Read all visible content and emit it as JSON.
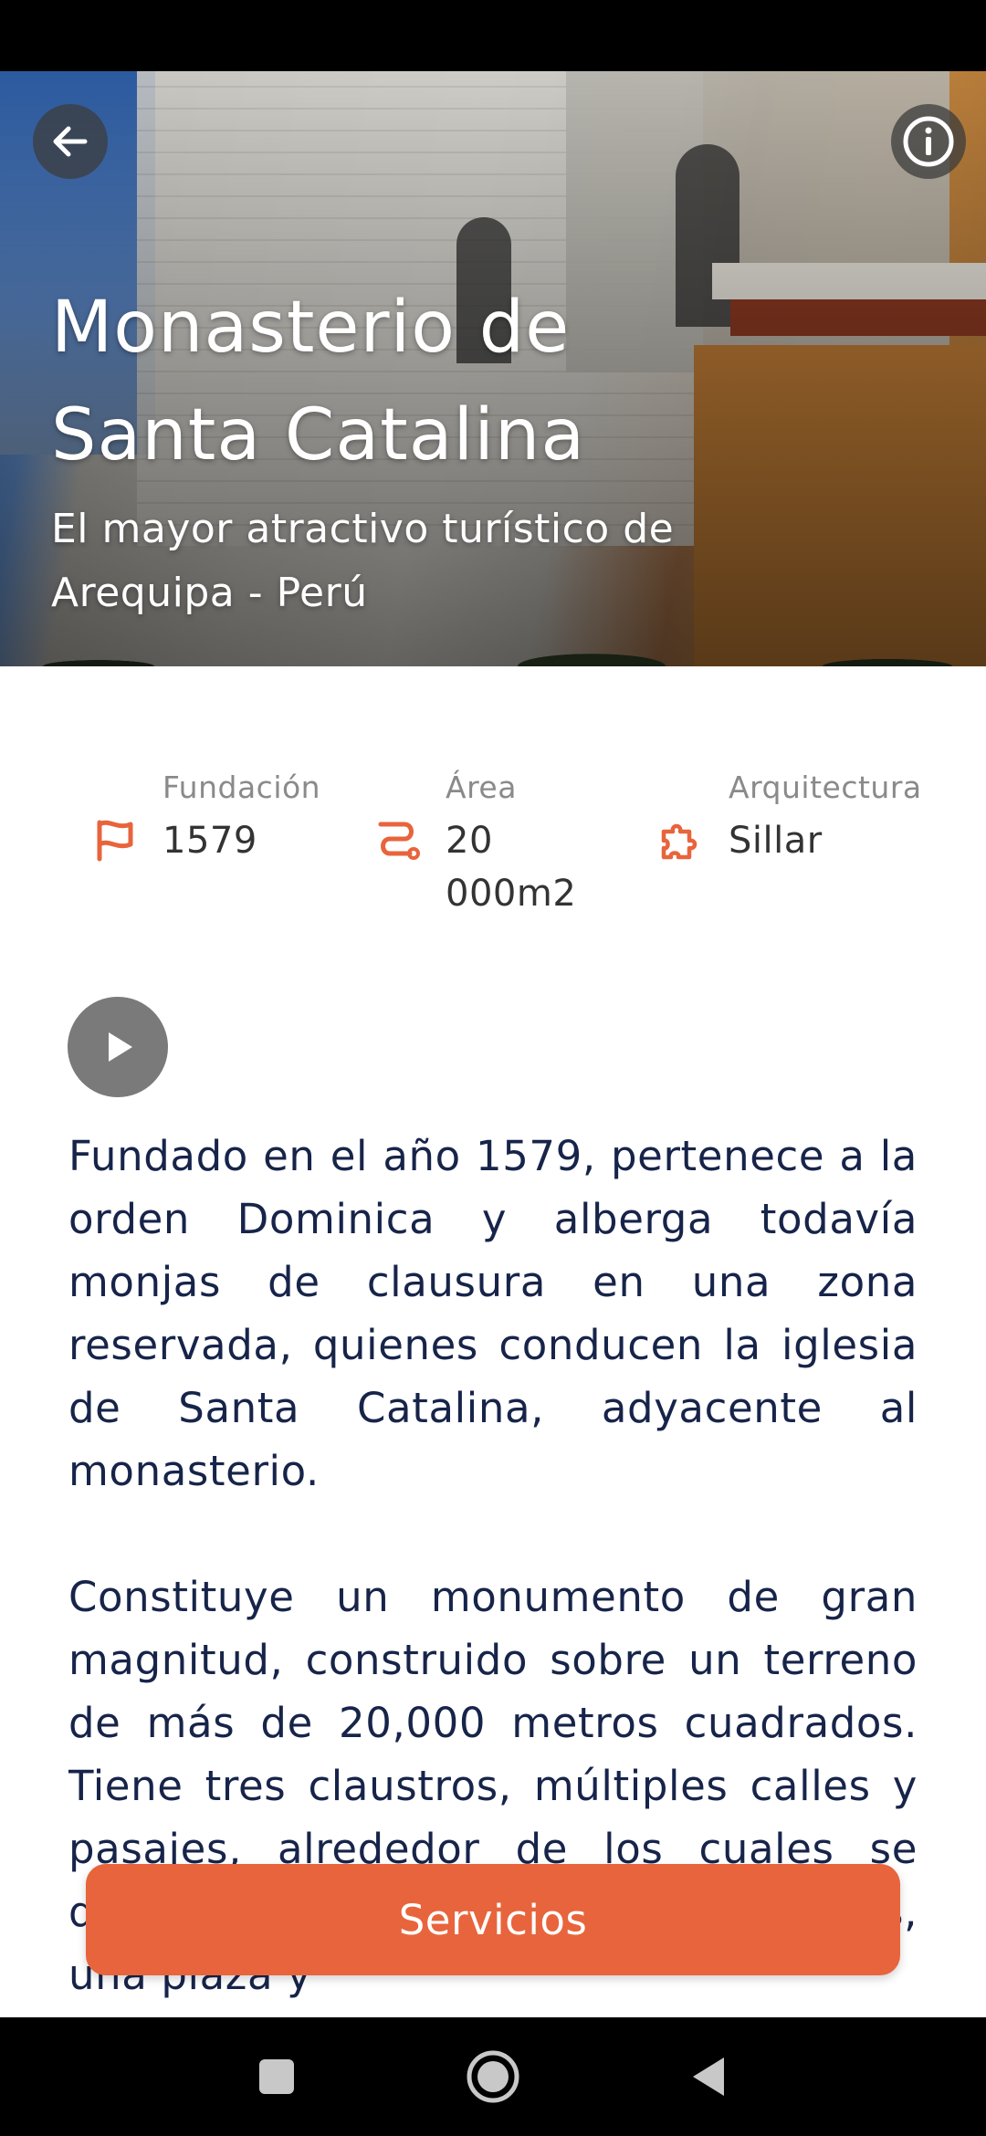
{
  "hero": {
    "title": "Monasterio de Santa Catalina",
    "subtitle": "El mayor atractivo turístico de Arequipa - Perú"
  },
  "stats": [
    {
      "label": "Fundación",
      "value": "1579",
      "icon": "flag-icon"
    },
    {
      "label": "Área",
      "value": "20 000m2",
      "icon": "route-icon"
    },
    {
      "label": "Arquitectura",
      "value": "Sillar",
      "icon": "puzzle-icon"
    }
  ],
  "description": {
    "paragraph_1": "Fundado en el año 1579, pertenece a la orden Dominica y alberga todavía monjas de clausura en una zona reservada, quienes conducen la iglesia de Santa Catalina, adyacente al monasterio.",
    "paragraph_2": "Constituye un monumento de gran magnitud, construido sobre un terreno de más de 20,000 metros cuadrados. Tiene tres claustros, múltiples calles y pasajes, alrededor de los cuales se distribuyen en viviendas de religiosas, una plaza y"
  },
  "actions": {
    "servicios_label": "Servicios"
  },
  "colors": {
    "accent": "#e8643c",
    "text_dark": "#17244a",
    "label_gray": "#8a8a8a"
  }
}
